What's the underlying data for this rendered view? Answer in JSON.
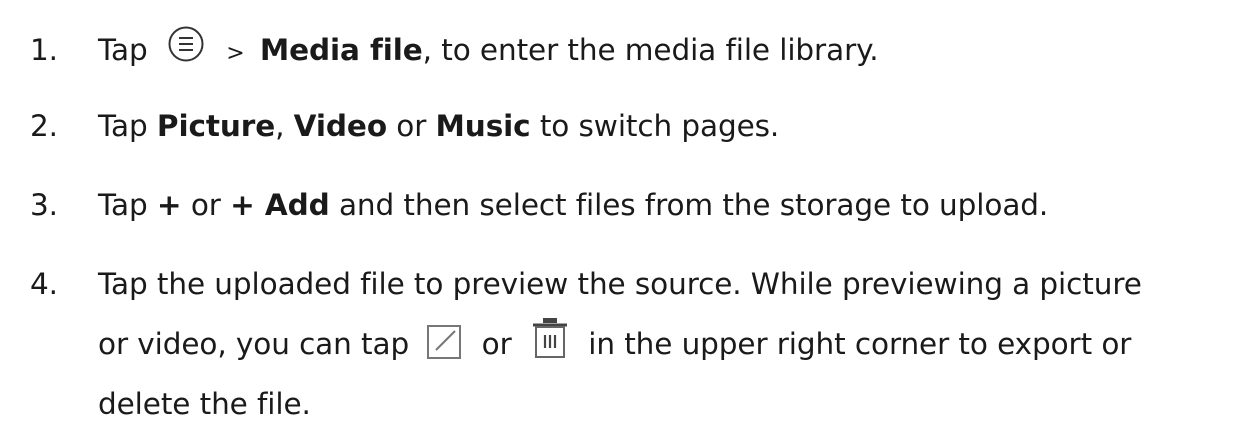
{
  "steps": [
    {
      "number": "1.",
      "tap": "Tap",
      "separator": ">",
      "target": "Media file",
      "rest": ", to enter the media file library.",
      "icon": "menu-circle-icon"
    },
    {
      "number": "2.",
      "tap": "Tap",
      "option1": "Picture",
      "comma": ",",
      "option2": "Video",
      "or": "or",
      "option3": "Music",
      "rest": "to switch pages."
    },
    {
      "number": "3.",
      "tap": "Tap",
      "plus": "+",
      "or": "or",
      "add": "+ Add",
      "rest": "and then select files from the storage to upload."
    },
    {
      "number": "4.",
      "line1": "Tap the uploaded file to preview the source. While previewing a picture",
      "line2_a": "or video, you can tap",
      "line2_or": "or",
      "line2_b": "in the upper right corner to export or",
      "line3": "delete the file.",
      "icon_export": "export-icon",
      "icon_delete": "trash-icon"
    }
  ]
}
